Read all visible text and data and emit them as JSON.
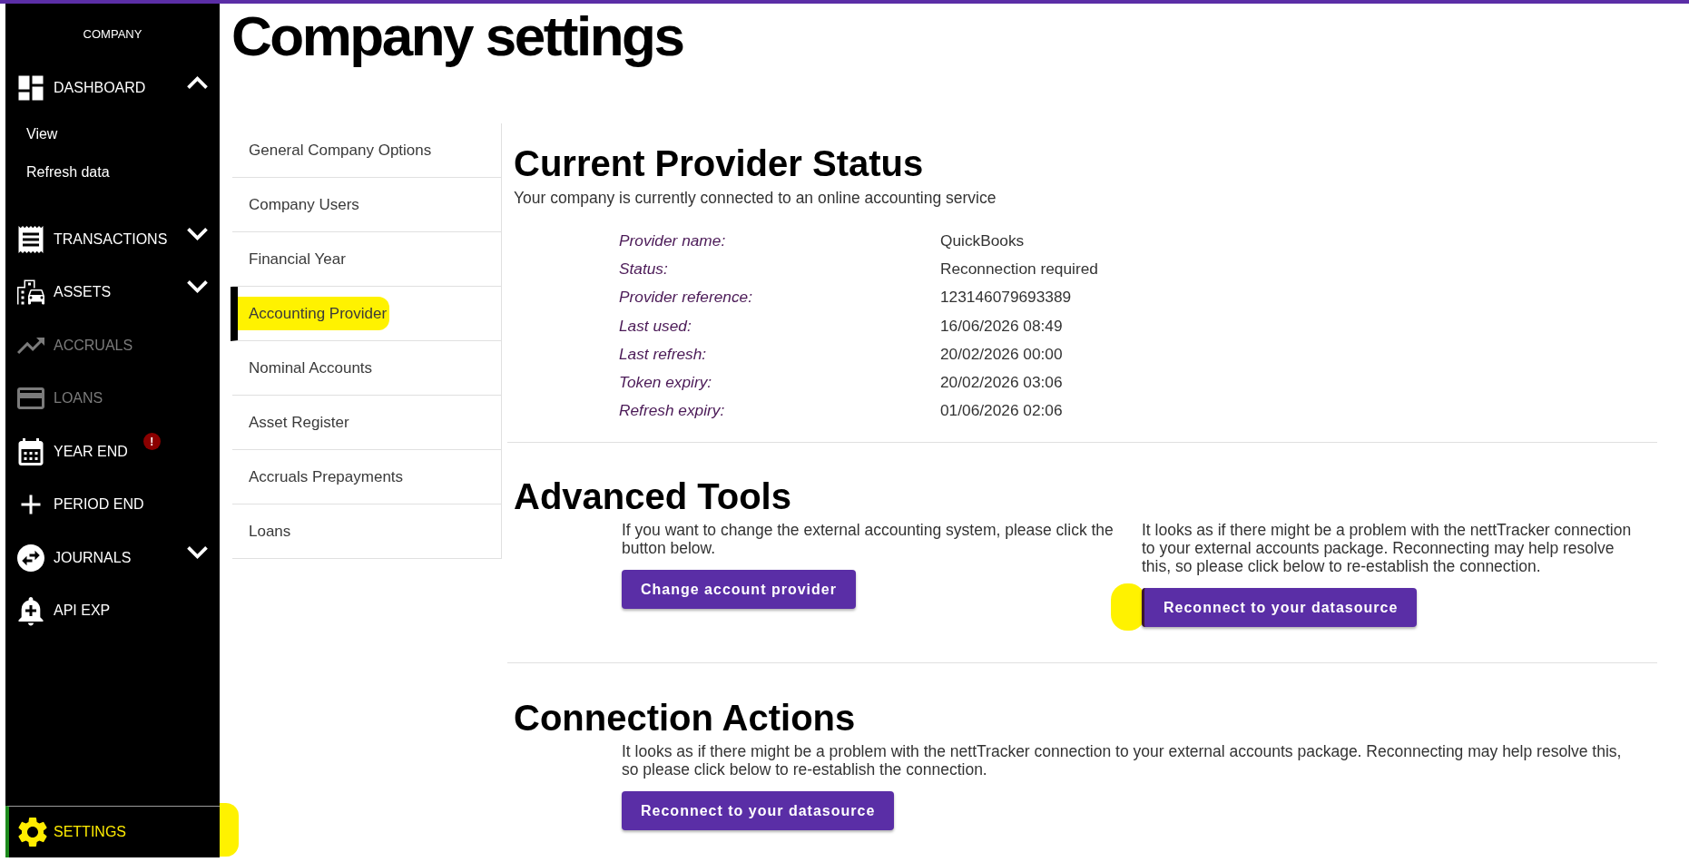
{
  "page_title": "Company settings",
  "sidebar": {
    "heading": "COMPANY",
    "items": [
      {
        "label": "DASHBOARD",
        "kind": "group",
        "expanded": true,
        "selected": false,
        "disabled": false,
        "children": [
          {
            "label": "View",
            "selected": false
          },
          {
            "label": "Refresh data",
            "selected": false
          }
        ]
      },
      {
        "label": "TRANSACTIONS",
        "kind": "group",
        "expanded": false,
        "selected": false,
        "disabled": false
      },
      {
        "label": "ASSETS",
        "kind": "group",
        "expanded": false,
        "selected": false,
        "disabled": false
      },
      {
        "label": "ACCRUALS",
        "kind": "link",
        "selected": false,
        "disabled": true
      },
      {
        "label": "LOANS",
        "kind": "link",
        "selected": false,
        "disabled": true
      },
      {
        "label": "YEAR END",
        "kind": "link",
        "selected": false,
        "disabled": false,
        "badge": "!"
      },
      {
        "label": "PERIOD END",
        "kind": "link",
        "selected": false,
        "disabled": false
      },
      {
        "label": "JOURNALS",
        "kind": "group",
        "expanded": false,
        "selected": false,
        "disabled": false
      },
      {
        "label": "API EXP",
        "kind": "link",
        "selected": false,
        "disabled": false
      }
    ],
    "footer_item": {
      "label": "SETTINGS",
      "selected": true,
      "highlighted": true
    }
  },
  "settings_nav": [
    {
      "label": "General Company Options",
      "selected": false,
      "highlighted": false
    },
    {
      "label": "Company Users",
      "selected": false,
      "highlighted": false
    },
    {
      "label": "Financial Year",
      "selected": false,
      "highlighted": false
    },
    {
      "label": "Accounting Provider",
      "selected": true,
      "highlighted": true
    },
    {
      "label": "Nominal Accounts",
      "selected": false,
      "highlighted": false
    },
    {
      "label": "Asset Register",
      "selected": false,
      "highlighted": false
    },
    {
      "label": "Accruals Prepayments",
      "selected": false,
      "highlighted": false
    },
    {
      "label": "Loans",
      "selected": false,
      "highlighted": false
    }
  ],
  "provider_status": {
    "title": "Current Provider Status",
    "subtitle": "Your company is currently connected to an online accounting service",
    "fields": [
      {
        "label": "Provider name:",
        "value": "QuickBooks"
      },
      {
        "label": "Status:",
        "value": "Reconnection required"
      },
      {
        "label": "Provider reference:",
        "value": "123146079693389"
      },
      {
        "label": "Last used:",
        "value": "16/06/2026 08:49"
      },
      {
        "label": "Last refresh:",
        "value": "20/02/2026 00:00"
      },
      {
        "label": "Token expiry:",
        "value": "20/02/2026 03:06"
      },
      {
        "label": "Refresh expiry:",
        "value": "01/06/2026 02:06"
      }
    ]
  },
  "advanced_tools": {
    "title": "Advanced Tools",
    "columns": [
      {
        "text": "If you want to change the external accounting system, please click the button below.",
        "button": {
          "label": "Change account provider",
          "highlighted": false
        }
      },
      {
        "text": "It looks as if there might be a problem with the nettTracker connection to your external accounts package. Reconnecting may help resolve this, so please click below to re-establish the connection.",
        "button": {
          "label": "Reconnect to your datasource",
          "highlighted": true
        }
      }
    ]
  },
  "connection_actions": {
    "title": "Connection Actions",
    "text": "It looks as if there might be a problem with the nettTracker connection to your external accounts package. Reconnecting may help resolve this, so please click below to re-establish the connection.",
    "button": {
      "label": "Reconnect to your datasource",
      "highlighted": false
    }
  }
}
